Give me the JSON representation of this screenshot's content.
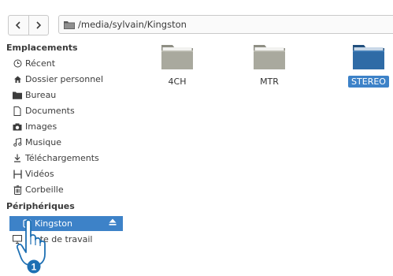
{
  "toolbar": {
    "back_icon": "chevron-left-icon",
    "forward_icon": "chevron-right-icon",
    "path": "/media/sylvain/Kingston"
  },
  "sidebar": {
    "places_header": "Emplacements",
    "places": [
      {
        "label": "Récent",
        "icon": "clock-icon"
      },
      {
        "label": "Dossier personnel",
        "icon": "home-icon"
      },
      {
        "label": "Bureau",
        "icon": "folder-icon"
      },
      {
        "label": "Documents",
        "icon": "document-icon"
      },
      {
        "label": "Images",
        "icon": "camera-icon"
      },
      {
        "label": "Musique",
        "icon": "music-icon"
      },
      {
        "label": "Téléchargements",
        "icon": "download-icon"
      },
      {
        "label": "Vidéos",
        "icon": "film-icon"
      },
      {
        "label": "Corbeille",
        "icon": "trash-icon"
      }
    ],
    "devices_header": "Périphériques",
    "devices": [
      {
        "label": "Kingston",
        "icon": "usb-drive-icon",
        "selected": true
      },
      {
        "label": "Poste de travail",
        "icon": "computer-icon"
      }
    ]
  },
  "files": [
    {
      "name": "4CH",
      "selected": false
    },
    {
      "name": "MTR",
      "selected": false
    },
    {
      "name": "STEREO",
      "selected": true
    }
  ],
  "callout": {
    "number": "1"
  },
  "colors": {
    "accent": "#3d82c8",
    "folder": "#a9a99e",
    "folder_selected": "#2f6ba6"
  }
}
